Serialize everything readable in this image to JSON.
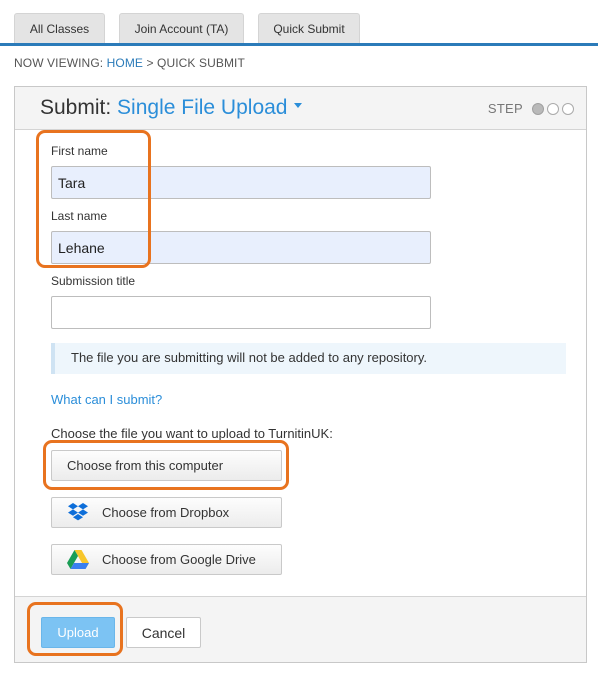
{
  "tabs": [
    {
      "label": "All Classes"
    },
    {
      "label": "Join Account (TA)"
    },
    {
      "label": "Quick Submit"
    }
  ],
  "breadcrumb": {
    "prefix": "NOW VIEWING:",
    "home": "HOME",
    "separator": ">",
    "current": "QUICK SUBMIT"
  },
  "panel": {
    "title_prefix": "Submit:",
    "mode": "Single File Upload",
    "step_label": "STEP",
    "step_current": 1,
    "step_total": 3
  },
  "form": {
    "first_name_label": "First name",
    "first_name_value": "Tara",
    "last_name_label": "Last name",
    "last_name_value": "Lehane",
    "submission_title_label": "Submission title",
    "submission_title_value": ""
  },
  "info_text": "The file you are submitting will not be added to any repository.",
  "help_link": "What can I submit?",
  "choose_label": "Choose the file you want to upload to TurnitinUK:",
  "buttons": {
    "choose_computer": "Choose from this computer",
    "choose_dropbox": "Choose from Dropbox",
    "choose_gdrive": "Choose from Google Drive",
    "upload": "Upload",
    "cancel": "Cancel"
  },
  "colors": {
    "accent": "#2b8ed9",
    "tab_border": "#2b7bb9",
    "highlight": "#e8731f",
    "upload_button": "#7cc3f3"
  }
}
